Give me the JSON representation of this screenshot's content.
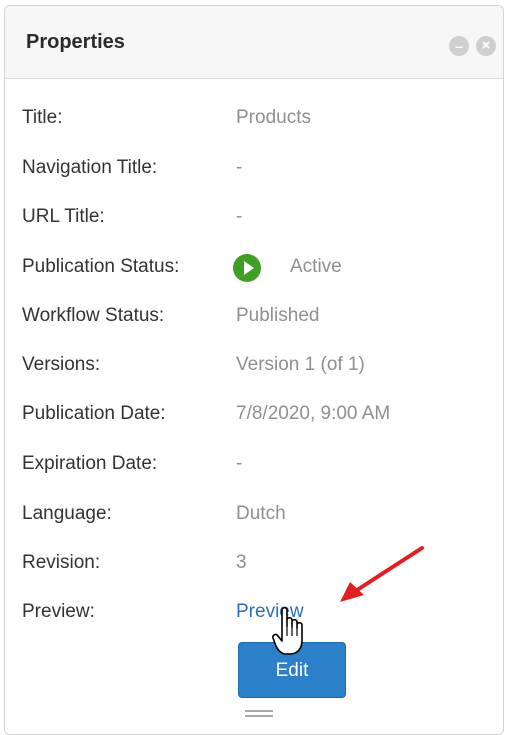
{
  "panel": {
    "title": "Properties",
    "header_buttons": [
      {
        "name": "minimize",
        "glyph": "–"
      },
      {
        "name": "close",
        "glyph": "×"
      }
    ]
  },
  "properties": {
    "title": {
      "label": "Title:",
      "value": "Products"
    },
    "navigation_title": {
      "label": "Navigation Title:",
      "value": "-"
    },
    "url_title": {
      "label": "URL Title:",
      "value": "-"
    },
    "publication_status": {
      "label": "Publication Status:",
      "value": "Active",
      "icon": "play-circle-icon",
      "icon_color": "#3f9f26"
    },
    "workflow_status": {
      "label": "Workflow Status:",
      "value": "Published"
    },
    "versions": {
      "label": "Versions:",
      "value": "Version 1 (of 1)"
    },
    "publication_date": {
      "label": "Publication Date:",
      "value": "7/8/2020, 9:00 AM"
    },
    "expiration_date": {
      "label": "Expiration Date:",
      "value": "-"
    },
    "language": {
      "label": "Language:",
      "value": "Dutch"
    },
    "revision": {
      "label": "Revision:",
      "value": "3"
    },
    "preview": {
      "label": "Preview:",
      "link_text": "Preview"
    }
  },
  "actions": {
    "edit_label": "Edit"
  },
  "colors": {
    "accent": "#2b80c9",
    "link": "#2a70b8",
    "annotation_arrow": "#e02020"
  }
}
